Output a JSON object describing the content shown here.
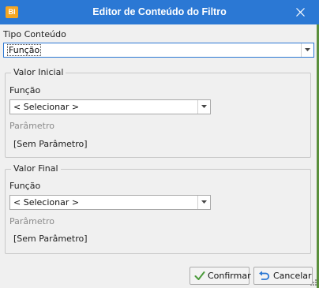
{
  "window": {
    "title": "Editor de Conteúdo do Filtro",
    "app_icon_text": "BI",
    "close_icon": "close-icon"
  },
  "tipo_conteudo": {
    "label": "Tipo Conteúdo",
    "value": "Função"
  },
  "valor_inicial": {
    "group_title": "Valor Inicial",
    "funcao_label": "Função",
    "funcao_value": "< Selecionar >",
    "parametro_label": "Parâmetro",
    "parametro_value": "[Sem Parâmetro]"
  },
  "valor_final": {
    "group_title": "Valor Final",
    "funcao_label": "Função",
    "funcao_value": "< Selecionar >",
    "parametro_label": "Parâmetro",
    "parametro_value": "[Sem Parâmetro]"
  },
  "buttons": {
    "confirm_label": "Confirmar",
    "confirm_icon": "checkmark-icon",
    "cancel_label": "Cancelar",
    "cancel_icon": "undo-icon"
  },
  "colors": {
    "titlebar": "#2b78d4",
    "app_icon": "#f5a623",
    "confirm_icon": "#4a9a3a",
    "cancel_icon": "#2b78d4"
  }
}
